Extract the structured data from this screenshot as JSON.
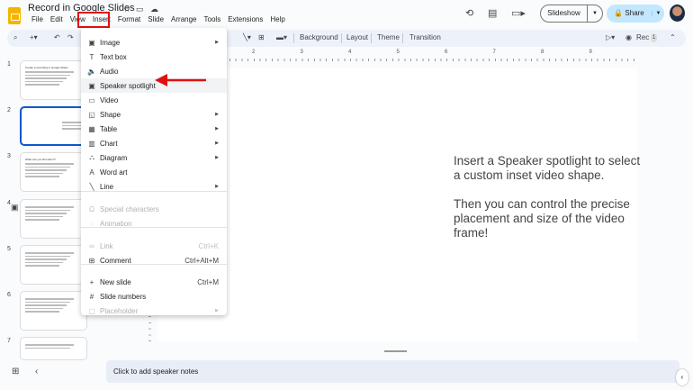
{
  "app": {
    "title": "Record in Google Slides",
    "menu": [
      "File",
      "Edit",
      "View",
      "Insert",
      "Format",
      "Slide",
      "Arrange",
      "Tools",
      "Extensions",
      "Help"
    ]
  },
  "header": {
    "slideshow": "Slideshow",
    "share": "Share"
  },
  "toolbar": {
    "background": "Background",
    "layout": "Layout",
    "theme": "Theme",
    "transition": "Transition",
    "rec": "Rec",
    "rec_count": "1"
  },
  "ruler": [
    "2",
    "3",
    "4",
    "5",
    "6",
    "7",
    "8",
    "9"
  ],
  "insert_menu": {
    "items": [
      {
        "label": "Image",
        "icon": "image-icon",
        "glyph": "▣",
        "submenu": true
      },
      {
        "label": "Text box",
        "icon": "text-box-icon",
        "glyph": "T"
      },
      {
        "label": "Audio",
        "icon": "audio-icon",
        "glyph": "🔈"
      },
      {
        "label": "Speaker spotlight",
        "icon": "speaker-spotlight-icon",
        "glyph": "▣",
        "highlighted": true
      },
      {
        "label": "Video",
        "icon": "video-icon",
        "glyph": "▭"
      },
      {
        "label": "Shape",
        "icon": "shape-icon",
        "glyph": "◱",
        "submenu": true
      },
      {
        "label": "Table",
        "icon": "table-icon",
        "glyph": "▦",
        "submenu": true
      },
      {
        "label": "Chart",
        "icon": "chart-icon",
        "glyph": "▥",
        "submenu": true
      },
      {
        "label": "Diagram",
        "icon": "diagram-icon",
        "glyph": "⛬",
        "submenu": true
      },
      {
        "label": "Word art",
        "icon": "word-art-icon",
        "glyph": "A"
      },
      {
        "label": "Line",
        "icon": "line-icon",
        "glyph": "╲",
        "submenu": true
      },
      {
        "label": "Special characters",
        "icon": "omega-icon",
        "glyph": "Ω",
        "disabled": true
      },
      {
        "label": "Animation",
        "icon": "animation-icon",
        "glyph": "◌",
        "disabled": true
      },
      {
        "label": "Link",
        "icon": "link-icon",
        "glyph": "∞",
        "disabled": true,
        "shortcut": "Ctrl+K"
      },
      {
        "label": "Comment",
        "icon": "comment-icon",
        "glyph": "⊞",
        "shortcut": "Ctrl+Alt+M"
      },
      {
        "label": "New slide",
        "icon": "plus-icon",
        "glyph": "+",
        "shortcut": "Ctrl+M"
      },
      {
        "label": "Slide numbers",
        "icon": "hash-icon",
        "glyph": "#"
      },
      {
        "label": "Placeholder",
        "icon": "placeholder-icon",
        "glyph": "▢",
        "disabled": true,
        "submenu": true
      }
    ]
  },
  "slides": [
    {
      "num": "1",
      "title": "Create a recording in Google Slides"
    },
    {
      "num": "2",
      "title": ""
    },
    {
      "num": "3",
      "title": "What can you DO with it?"
    },
    {
      "num": "4",
      "title": ""
    },
    {
      "num": "5",
      "title": ""
    },
    {
      "num": "6",
      "title": ""
    },
    {
      "num": "7",
      "title": ""
    }
  ],
  "slide": {
    "p1": "Insert a Speaker spotlight to select a custom inset video shape.",
    "p2": "Then you can control the precise placement and size of the video frame!"
  },
  "notes": {
    "placeholder": "Click to add speaker notes"
  },
  "colors": {
    "highlight_box": "#e01010",
    "accent": "#0b57d0",
    "share_bg": "#c2e7ff"
  }
}
